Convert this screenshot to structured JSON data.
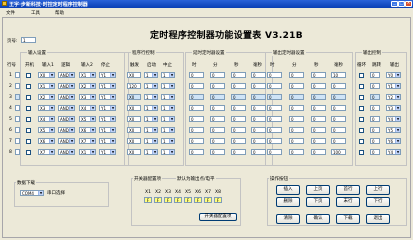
{
  "window": {
    "title": "王宇·步新科技·时控定时程序控制器",
    "min": "_",
    "max": "□",
    "close": "×"
  },
  "menu": [
    "文件",
    "工具",
    "帮助"
  ],
  "title": "定时程序控制器功能设置表 V3.21B",
  "page_no": {
    "label": "页号:",
    "value": "1"
  },
  "row_header": "行号",
  "groups": {
    "input": {
      "label": "输入设置",
      "cols": [
        "开机",
        "输入1",
        "逻辑",
        "输入2",
        "停止"
      ]
    },
    "program": {
      "label": "程序行控制",
      "cols": [
        "触发",
        "启动",
        "中止"
      ]
    },
    "timer": {
      "label": "延时定时器设置",
      "cols": [
        "时",
        "分",
        "秒",
        "毫秒"
      ]
    },
    "output_timer": {
      "label": "输出定时器设置",
      "cols": [
        "时",
        "分",
        "秒",
        "毫秒"
      ]
    },
    "output_ctrl": {
      "label": "输出控制",
      "cols": [
        "循环",
        "跳转",
        "输出"
      ]
    }
  },
  "rows": [
    {
      "n": "1",
      "in1": "X0",
      "logic": "AND",
      "in2": "X1",
      "stop": "Y1",
      "trig": "X0",
      "start": "1",
      "stopn": "1",
      "t": [
        "0",
        "0",
        "0",
        "0"
      ],
      "o": [
        "0",
        "0",
        "0",
        "10"
      ],
      "jump": "0",
      "out": "Y0"
    },
    {
      "n": "2",
      "in1": "X1",
      "logic": "AND",
      "in2": "X2",
      "stop": "Y1",
      "trig": "120",
      "start": "1",
      "stopn": "1",
      "t": [
        "0",
        "0",
        "0",
        "0"
      ],
      "o": [
        "0",
        "0",
        "0",
        "0"
      ],
      "jump": "0",
      "out": "Y1"
    },
    {
      "n": "3",
      "in1": "X2",
      "logic": "AND",
      "in2": "X3",
      "stop": "Y1",
      "trig": "X0",
      "start": "1",
      "stopn": "1",
      "t": [
        "0",
        "0",
        "0",
        "0"
      ],
      "o": [
        "0",
        "0",
        "0",
        "0"
      ],
      "jump": "0",
      "out": "Y2"
    },
    {
      "n": "4",
      "in1": "X3",
      "logic": "AND",
      "in2": "X4",
      "stop": "Y1",
      "trig": "X0",
      "start": "1",
      "stopn": "1",
      "t": [
        "0",
        "0",
        "0",
        "0"
      ],
      "o": [
        "0",
        "0",
        "0",
        "0"
      ],
      "jump": "0",
      "out": "Y3"
    },
    {
      "n": "5",
      "in1": "X4",
      "logic": "AND",
      "in2": "X5",
      "stop": "Y1",
      "trig": "X0",
      "start": "1",
      "stopn": "1",
      "t": [
        "0",
        "0",
        "0",
        "0"
      ],
      "o": [
        "0",
        "0",
        "0",
        "0"
      ],
      "jump": "0",
      "out": "Y4"
    },
    {
      "n": "6",
      "in1": "X5",
      "logic": "AND",
      "in2": "X6",
      "stop": "Y1",
      "trig": "X0",
      "start": "1",
      "stopn": "1",
      "t": [
        "0",
        "0",
        "0",
        "0"
      ],
      "o": [
        "0",
        "0",
        "0",
        "0"
      ],
      "jump": "0",
      "out": "Y5"
    },
    {
      "n": "7",
      "in1": "X6",
      "logic": "AND",
      "in2": "X7",
      "stop": "Y1",
      "trig": "X0",
      "start": "1",
      "stopn": "1",
      "t": [
        "0",
        "0",
        "0",
        "0"
      ],
      "o": [
        "0",
        "0",
        "0",
        "0"
      ],
      "jump": "0",
      "out": "Y6"
    },
    {
      "n": "8",
      "in1": "X7",
      "logic": "AND",
      "in2": "X1",
      "stop": "Y1",
      "trig": "X0",
      "start": "1",
      "stopn": "1",
      "t": [
        "0",
        "0",
        "0",
        "0"
      ],
      "o": [
        "0",
        "0",
        "0",
        "100"
      ],
      "jump": "0",
      "out": "Y4"
    }
  ],
  "download": {
    "label": "数据下载",
    "port": "COM4",
    "port_label": "串口选择"
  },
  "io_group": {
    "label": "开关器配置项",
    "sub": "默认为输出点/电平",
    "cols": [
      "X1",
      "X2",
      "X3",
      "X4",
      "X5",
      "X6",
      "X7",
      "X8"
    ],
    "vals": [
      "F",
      "F",
      "F",
      "F",
      "F",
      "F",
      "F",
      "F"
    ],
    "button": "开关器配置项"
  },
  "ops": {
    "label": "操作按钮",
    "buttons": [
      "插入",
      "上页",
      "首行",
      "上行",
      "删除",
      "下页",
      "末行",
      "下行",
      "清除",
      "确认",
      "下载",
      "退出"
    ]
  },
  "colors": {
    "titlebar": "#0a3fb4",
    "face": "#ece9d8",
    "selected_row": "#cfe4f7",
    "yellow_field": "#ffff80"
  }
}
